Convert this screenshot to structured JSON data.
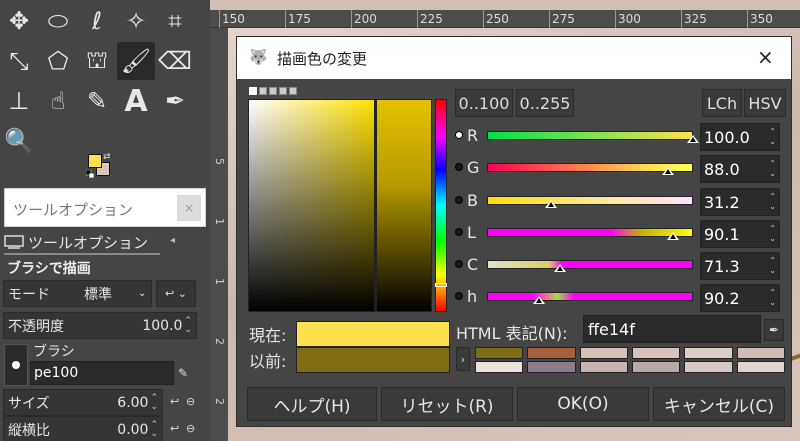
{
  "toolbox": {
    "tools": [
      {
        "name": "move-tool",
        "glyph": "✥"
      },
      {
        "name": "ellipse-select-tool",
        "glyph": "⬭"
      },
      {
        "name": "free-select-tool",
        "glyph": "ℓ"
      },
      {
        "name": "fuzzy-select-tool",
        "glyph": "✧"
      },
      {
        "name": "crop-tool",
        "glyph": "⌗"
      },
      {
        "name": "scale-tool",
        "glyph": "⤡"
      },
      {
        "name": "cage-transform-tool",
        "glyph": "⬠"
      },
      {
        "name": "bucket-fill-tool",
        "glyph": "⛫"
      },
      {
        "name": "paintbrush-tool",
        "glyph": "🖌"
      },
      {
        "name": "eraser-tool",
        "glyph": "⌫"
      },
      {
        "name": "clone-tool",
        "glyph": "⊥"
      },
      {
        "name": "smudge-tool",
        "glyph": "☝"
      },
      {
        "name": "paths-tool",
        "glyph": "✎"
      },
      {
        "name": "text-tool",
        "glyph": "A"
      },
      {
        "name": "color-picker-tool",
        "glyph": "✒"
      },
      {
        "name": "zoom-tool",
        "glyph": "🔍"
      }
    ],
    "fg_color": "#ffe14f",
    "bg_color": "#d9c6bd"
  },
  "tooltip": {
    "text": "ツールオプション",
    "close": "×"
  },
  "tool_options": {
    "tab_label": "ツールオプション",
    "menu_glyph": "◂",
    "title": "ブラシで描画",
    "mode_label": "モード",
    "mode_value": "標準",
    "mode_arrow": "⌄",
    "mode_btn": "↩ ⌄",
    "opacity_label": "不透明度",
    "opacity_value": "100.0",
    "brush_label": "ブラシ",
    "brush_name": "pe100",
    "size_label": "サイズ",
    "size_value": "6.00",
    "ratio_label": "縦横比",
    "ratio_value": "0.00"
  },
  "ruler": {
    "top_ticks": [
      "150",
      "175",
      "200",
      "225",
      "250",
      "275",
      "300",
      "325",
      "350"
    ],
    "left_ticks": [
      "5",
      "1",
      "1",
      "2",
      "2"
    ]
  },
  "dialog": {
    "title": "描画色の変更",
    "close": "×",
    "range1": "0..100",
    "range2": "0..255",
    "lch": "LCh",
    "hsv": "HSV",
    "channels": [
      {
        "id": "R",
        "label": "R",
        "value": "100.0",
        "marker": 100.0,
        "selected": true
      },
      {
        "id": "G",
        "label": "G",
        "value": "88.0",
        "marker": 88.0,
        "selected": false
      },
      {
        "id": "B",
        "label": "B",
        "value": "31.2",
        "marker": 31.2,
        "selected": false
      },
      {
        "id": "L",
        "label": "L",
        "value": "90.1",
        "marker": 90.1,
        "selected": false
      },
      {
        "id": "C",
        "label": "C",
        "value": "71.3",
        "marker": 35.6,
        "selected": false
      },
      {
        "id": "h",
        "label": "h",
        "value": "90.2",
        "marker": 25.0,
        "selected": false
      }
    ],
    "current_label": "現在:",
    "old_label": "以前:",
    "current_color": "#ffe14f",
    "old_color": "#7e6d13",
    "html_label": "HTML 表記(N):",
    "html_value": "ffe14f",
    "history_colors": [
      "#7e6d13",
      "#a5603e",
      "#d6c1b8",
      "#d8c2b9",
      "#dccdc5",
      "#d0bdb4",
      "#ede2dc",
      "#8a7c8a",
      "#c9b5b0",
      "#b8a9a9",
      "#d8c8c4",
      "#e1d3cd"
    ],
    "buttons": {
      "help": "ヘルプ(H)",
      "reset": "リセット(R)",
      "ok": "OK(O)",
      "cancel": "キャンセル(C)"
    }
  }
}
